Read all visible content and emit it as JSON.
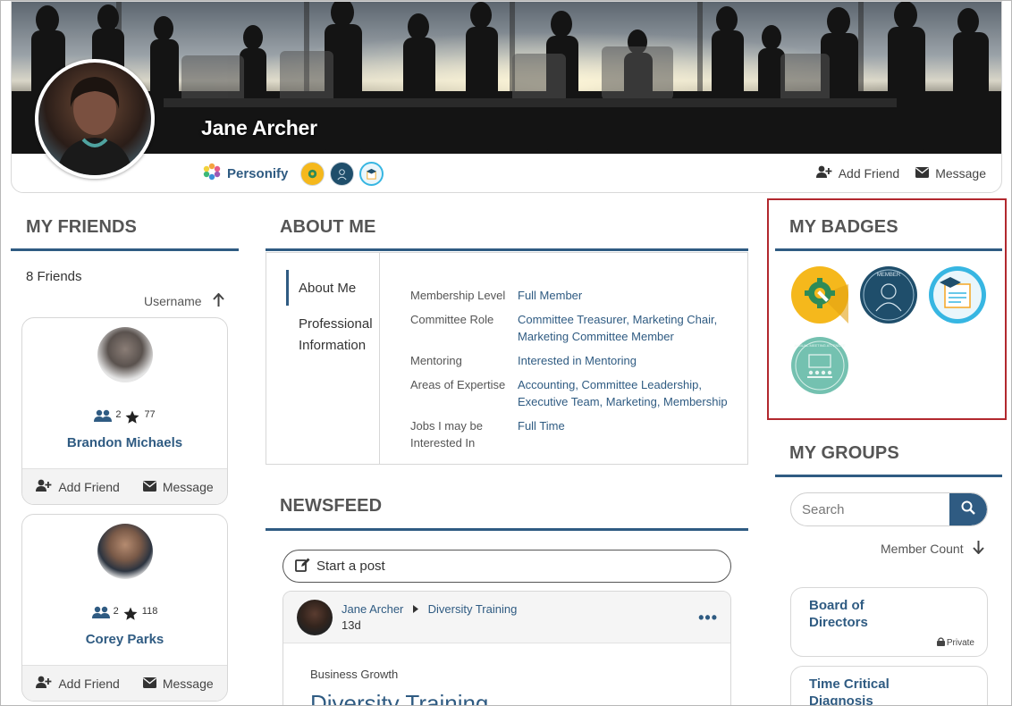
{
  "profile": {
    "name": "Jane Archer",
    "organization": "Personify",
    "header_badges": [
      "gear-badge",
      "member-badge",
      "graduation-badge"
    ],
    "actions": {
      "add_friend": "Add Friend",
      "message": "Message"
    }
  },
  "friends": {
    "heading": "MY FRIENDS",
    "count_label": "8 Friends",
    "sort_label": "Username",
    "items": [
      {
        "name": "Brandon Michaels",
        "friends": "2",
        "points": "77",
        "add_friend": "Add Friend",
        "message": "Message"
      },
      {
        "name": "Corey Parks",
        "friends": "2",
        "points": "118",
        "add_friend": "Add Friend",
        "message": "Message"
      }
    ]
  },
  "about": {
    "heading": "ABOUT ME",
    "tabs": [
      "About Me",
      "Professional Information"
    ],
    "rows": [
      {
        "label": "Membership Level",
        "value": "Full Member"
      },
      {
        "label": "Committee Role",
        "value": "Committee Treasurer, Marketing Chair, Marketing Committee Member"
      },
      {
        "label": "Mentoring",
        "value": "Interested in Mentoring"
      },
      {
        "label": "Areas of Expertise",
        "value": "Accounting, Committee Leadership, Executive Team, Marketing, Membership"
      },
      {
        "label": "Jobs I may be Interested In",
        "value": "Full Time"
      }
    ]
  },
  "newsfeed": {
    "heading": "NEWSFEED",
    "start_post": "Start a post",
    "post": {
      "author": "Jane Archer",
      "group": "Diversity Training",
      "time": "13d",
      "category": "Business Growth",
      "title": "Diversity Training"
    }
  },
  "badges": {
    "heading": "MY BADGES",
    "items": [
      "gear-badge",
      "member-badge",
      "graduation-badge",
      "annual-meeting-attendee-badge"
    ],
    "member_text": "MEMBER",
    "attendee_text": "ANNUAL MEETING ATTENDEE"
  },
  "groups": {
    "heading": "MY GROUPS",
    "search_placeholder": "Search",
    "sort_label": "Member Count",
    "items": [
      {
        "name": "Board of Directors",
        "privacy": "Private"
      },
      {
        "name": "Time Critical Diagnosis",
        "privacy": ""
      }
    ]
  },
  "colors": {
    "accent": "#2f5b82",
    "highlight": "#b2282e",
    "badge_yellow": "#f5b81c",
    "badge_navy": "#1f4e6b",
    "badge_teal": "#74c1b0",
    "badge_cyan": "#37b6e2"
  }
}
